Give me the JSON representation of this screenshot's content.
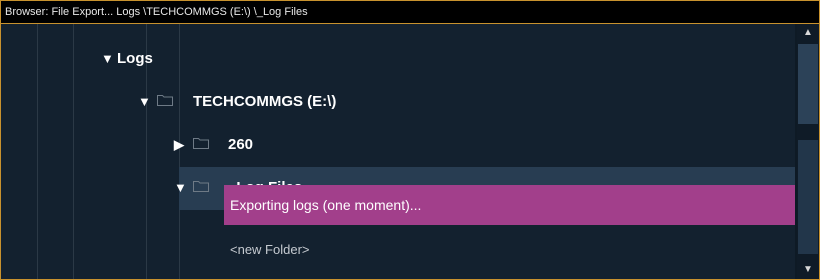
{
  "window": {
    "title": "Browser: File Export... Logs \\TECHCOMMGS (E:\\) \\_Log Files"
  },
  "tree": {
    "items": [
      {
        "label": "Logs",
        "expanded": true,
        "folder_icon": false
      },
      {
        "label": "TECHCOMMGS (E:\\)",
        "expanded": true,
        "folder_icon": true
      },
      {
        "label": "260",
        "expanded": false,
        "folder_icon": true
      },
      {
        "label": "_Log Files",
        "expanded": true,
        "folder_icon": true,
        "selected": true
      }
    ],
    "status_message": "Exporting logs (one moment)...",
    "new_folder_label": "<new Folder>"
  },
  "icons": {
    "expanded": "chevron-down-icon",
    "collapsed": "chevron-right-icon",
    "folder": "folder-icon",
    "scroll_up": "scroll-up-icon",
    "scroll_down": "scroll-down-icon"
  },
  "colors": {
    "border_accent": "#c8922e",
    "background": "#13212f",
    "selected_row": "#283d52",
    "status_bar": "#a23f8b"
  }
}
